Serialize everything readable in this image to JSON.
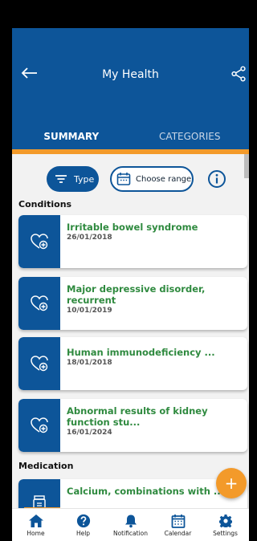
{
  "header": {
    "title": "My Health",
    "back_icon": "arrow-left-icon",
    "share_icon": "share-icon"
  },
  "tabs": [
    {
      "label": "SUMMARY",
      "active": true
    },
    {
      "label": "CATEGORIES",
      "active": false
    }
  ],
  "filters": {
    "type_label": "Type",
    "range_label": "Choose range",
    "info_icon": "info-icon"
  },
  "sections": {
    "conditions": "Conditions",
    "medication": "Medication"
  },
  "conditions": [
    {
      "title": "Irritable bowel syndrome",
      "date": "26/01/2018"
    },
    {
      "title": "Major depressive disorder, recurrent",
      "date": "10/01/2019"
    },
    {
      "title": "Human immunodeficiency ...",
      "date": "18/01/2018"
    },
    {
      "title": "Abnormal results of kidney function stu...",
      "date": "16/01/2024"
    }
  ],
  "medication": [
    {
      "title": "Calcium, combinations with ..."
    }
  ],
  "fab_label": "+",
  "nav": [
    {
      "label": "Home",
      "icon": "home-icon"
    },
    {
      "label": "Help",
      "icon": "help-icon"
    },
    {
      "label": "Notification",
      "icon": "bell-icon"
    },
    {
      "label": "Calendar",
      "icon": "calendar-icon"
    },
    {
      "label": "Settings",
      "icon": "gear-icon"
    }
  ],
  "colors": {
    "primary": "#0d5599",
    "accent": "#f39a2a",
    "condition_title": "#2f8a3f"
  }
}
